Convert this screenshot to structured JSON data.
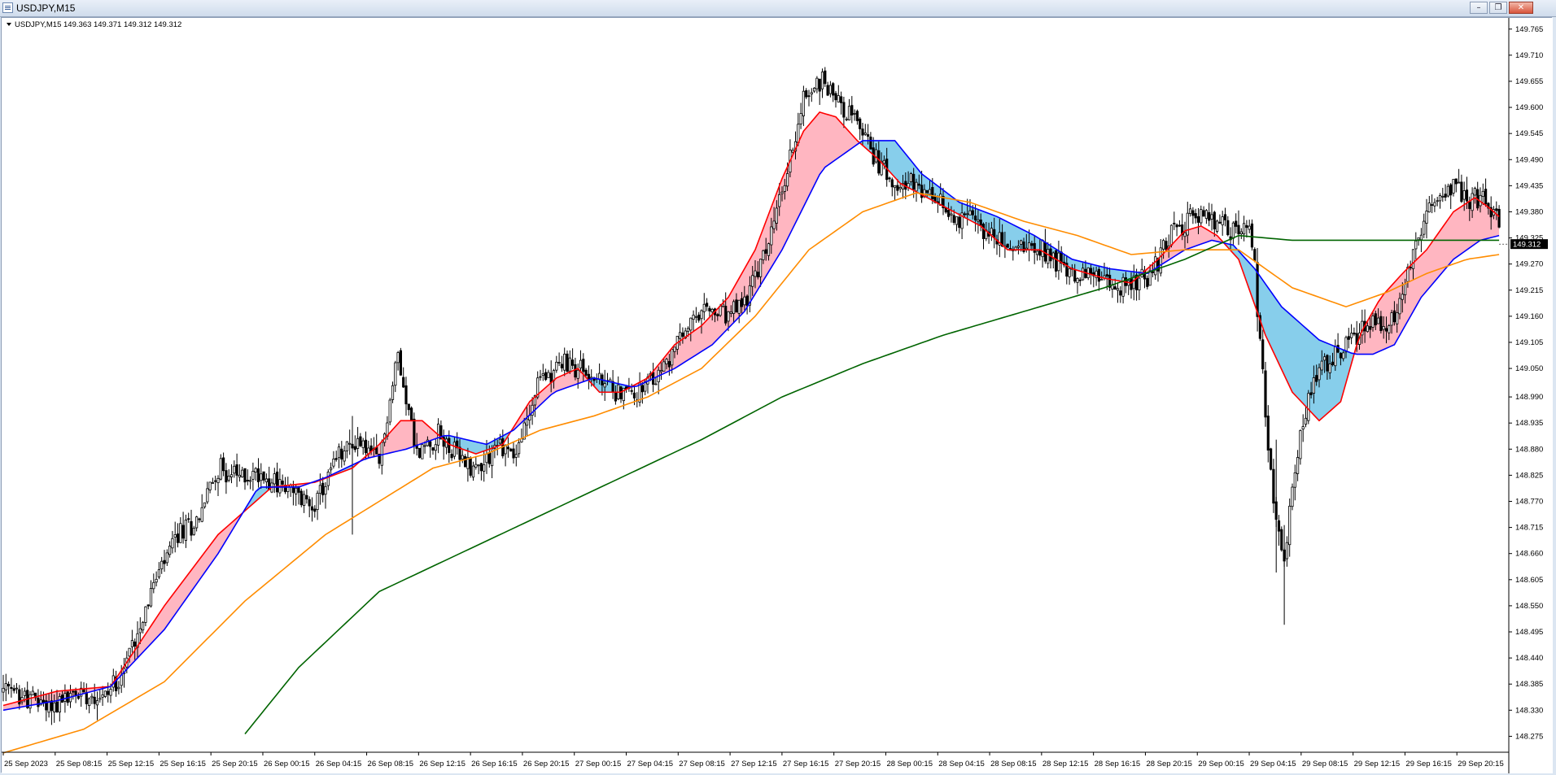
{
  "window": {
    "title": "USDJPY,M15",
    "buttons": [
      "minimize",
      "restore",
      "close"
    ]
  },
  "chart_data": {
    "type": "candlestick",
    "symbol_header": "USDJPY,M15  149.363 149.371 149.312 149.312",
    "current_price_label": "149.312",
    "ylim": [
      148.25,
      149.78
    ],
    "y_ticks": [
      "149.765",
      "149.710",
      "149.655",
      "149.600",
      "149.545",
      "149.490",
      "149.435",
      "149.380",
      "149.325",
      "149.270",
      "149.215",
      "149.160",
      "149.105",
      "149.050",
      "148.990",
      "148.935",
      "148.880",
      "148.825",
      "148.770",
      "148.715",
      "148.660",
      "148.605",
      "148.550",
      "148.495",
      "148.440",
      "148.385",
      "148.330",
      "148.275"
    ],
    "x_ticks": [
      "25 Sep 2023",
      "25 Sep 08:15",
      "25 Sep 12:15",
      "25 Sep 16:15",
      "25 Sep 20:15",
      "26 Sep 00:15",
      "26 Sep 04:15",
      "26 Sep 08:15",
      "26 Sep 12:15",
      "26 Sep 16:15",
      "26 Sep 20:15",
      "27 Sep 00:15",
      "27 Sep 04:15",
      "27 Sep 08:15",
      "27 Sep 12:15",
      "27 Sep 16:15",
      "27 Sep 20:15",
      "28 Sep 00:15",
      "28 Sep 04:15",
      "28 Sep 08:15",
      "28 Sep 12:15",
      "28 Sep 16:15",
      "28 Sep 20:15",
      "29 Sep 00:15",
      "29 Sep 04:15",
      "29 Sep 08:15",
      "29 Sep 12:15",
      "29 Sep 16:15",
      "29 Sep 20:15"
    ],
    "close_path": [
      [
        0,
        148.37
      ],
      [
        18,
        148.34
      ],
      [
        30,
        148.37
      ],
      [
        38,
        148.36
      ],
      [
        45,
        148.42
      ],
      [
        55,
        148.58
      ],
      [
        65,
        148.7
      ],
      [
        72,
        148.73
      ],
      [
        80,
        148.84
      ],
      [
        88,
        148.82
      ],
      [
        96,
        148.83
      ],
      [
        104,
        148.8
      ],
      [
        112,
        148.77
      ],
      [
        117,
        148.77
      ],
      [
        124,
        148.86
      ],
      [
        132,
        148.9
      ],
      [
        140,
        148.85
      ],
      [
        147,
        149.08
      ],
      [
        154,
        148.87
      ],
      [
        162,
        148.91
      ],
      [
        170,
        148.86
      ],
      [
        176,
        148.84
      ],
      [
        184,
        148.89
      ],
      [
        191,
        148.87
      ],
      [
        200,
        149.03
      ],
      [
        208,
        149.06
      ],
      [
        215,
        149.05
      ],
      [
        222,
        149.02
      ],
      [
        230,
        149.0
      ],
      [
        238,
        149.0
      ],
      [
        246,
        149.05
      ],
      [
        254,
        149.13
      ],
      [
        262,
        149.17
      ],
      [
        270,
        149.16
      ],
      [
        276,
        149.19
      ],
      [
        283,
        149.28
      ],
      [
        290,
        149.42
      ],
      [
        298,
        149.62
      ],
      [
        305,
        149.66
      ],
      [
        313,
        149.6
      ],
      [
        320,
        149.55
      ],
      [
        326,
        149.48
      ],
      [
        333,
        149.45
      ],
      [
        340,
        149.43
      ],
      [
        347,
        149.4
      ],
      [
        355,
        149.37
      ],
      [
        362,
        149.36
      ],
      [
        368,
        149.33
      ],
      [
        375,
        149.3
      ],
      [
        383,
        149.32
      ],
      [
        390,
        149.29
      ],
      [
        398,
        149.25
      ],
      [
        405,
        149.25
      ],
      [
        413,
        149.22
      ],
      [
        420,
        149.23
      ],
      [
        427,
        149.24
      ],
      [
        433,
        149.32
      ],
      [
        440,
        149.36
      ],
      [
        447,
        149.37
      ],
      [
        453,
        149.35
      ],
      [
        460,
        149.34
      ],
      [
        465,
        149.33
      ],
      [
        470,
        148.95
      ],
      [
        474,
        148.72
      ],
      [
        477,
        148.65
      ],
      [
        481,
        148.85
      ],
      [
        486,
        148.98
      ],
      [
        491,
        149.05
      ],
      [
        497,
        149.08
      ],
      [
        503,
        149.12
      ],
      [
        509,
        149.15
      ],
      [
        515,
        149.12
      ],
      [
        520,
        149.2
      ],
      [
        526,
        149.3
      ],
      [
        532,
        149.4
      ],
      [
        538,
        149.43
      ],
      [
        545,
        149.41
      ],
      [
        551,
        149.4
      ],
      [
        557,
        149.36
      ],
      [
        560,
        149.31
      ]
    ],
    "indicators": [
      {
        "name": "EMA fast",
        "color": "#ff0000",
        "points": [
          [
            0,
            148.34
          ],
          [
            20,
            148.37
          ],
          [
            40,
            148.38
          ],
          [
            60,
            148.55
          ],
          [
            80,
            148.7
          ],
          [
            100,
            148.8
          ],
          [
            116,
            148.81
          ],
          [
            130,
            148.84
          ],
          [
            140,
            148.89
          ],
          [
            148,
            148.94
          ],
          [
            156,
            148.94
          ],
          [
            166,
            148.89
          ],
          [
            176,
            148.87
          ],
          [
            186,
            148.89
          ],
          [
            196,
            148.98
          ],
          [
            206,
            149.03
          ],
          [
            214,
            149.05
          ],
          [
            222,
            149.0
          ],
          [
            230,
            149.0
          ],
          [
            240,
            149.03
          ],
          [
            250,
            149.1
          ],
          [
            260,
            149.14
          ],
          [
            270,
            149.2
          ],
          [
            280,
            149.3
          ],
          [
            290,
            149.45
          ],
          [
            298,
            149.55
          ],
          [
            304,
            149.59
          ],
          [
            310,
            149.58
          ],
          [
            318,
            149.53
          ],
          [
            326,
            149.49
          ],
          [
            334,
            149.44
          ],
          [
            344,
            149.41
          ],
          [
            354,
            149.38
          ],
          [
            364,
            149.35
          ],
          [
            374,
            149.3
          ],
          [
            386,
            149.3
          ],
          [
            398,
            149.26
          ],
          [
            410,
            149.24
          ],
          [
            420,
            149.23
          ],
          [
            430,
            149.28
          ],
          [
            440,
            149.34
          ],
          [
            446,
            149.35
          ],
          [
            452,
            149.33
          ],
          [
            460,
            149.28
          ],
          [
            470,
            149.12
          ],
          [
            480,
            149.0
          ],
          [
            490,
            148.94
          ],
          [
            498,
            148.98
          ],
          [
            505,
            149.12
          ],
          [
            513,
            149.2
          ],
          [
            521,
            149.25
          ],
          [
            530,
            149.3
          ],
          [
            540,
            149.38
          ],
          [
            548,
            149.41
          ],
          [
            553,
            149.39
          ],
          [
            557,
            149.37
          ]
        ]
      },
      {
        "name": "EMA medium",
        "color": "#0000ff",
        "points": [
          [
            0,
            148.33
          ],
          [
            20,
            148.35
          ],
          [
            40,
            148.38
          ],
          [
            60,
            148.5
          ],
          [
            80,
            148.66
          ],
          [
            95,
            148.8
          ],
          [
            110,
            148.8
          ],
          [
            120,
            148.82
          ],
          [
            135,
            148.86
          ],
          [
            150,
            148.88
          ],
          [
            165,
            148.91
          ],
          [
            180,
            148.89
          ],
          [
            190,
            148.92
          ],
          [
            205,
            149.0
          ],
          [
            220,
            149.03
          ],
          [
            235,
            149.01
          ],
          [
            250,
            149.05
          ],
          [
            264,
            149.1
          ],
          [
            276,
            149.17
          ],
          [
            290,
            149.3
          ],
          [
            305,
            149.47
          ],
          [
            320,
            149.53
          ],
          [
            332,
            149.53
          ],
          [
            342,
            149.46
          ],
          [
            356,
            149.4
          ],
          [
            370,
            149.37
          ],
          [
            384,
            149.33
          ],
          [
            398,
            149.28
          ],
          [
            412,
            149.26
          ],
          [
            426,
            149.25
          ],
          [
            440,
            149.3
          ],
          [
            450,
            149.32
          ],
          [
            458,
            149.31
          ],
          [
            466,
            149.26
          ],
          [
            476,
            149.18
          ],
          [
            490,
            149.11
          ],
          [
            503,
            149.08
          ],
          [
            510,
            149.08
          ],
          [
            518,
            149.1
          ],
          [
            528,
            149.2
          ],
          [
            540,
            149.28
          ],
          [
            550,
            149.32
          ],
          [
            557,
            149.33
          ]
        ]
      },
      {
        "name": "EMA slow",
        "color": "#ff8c00",
        "points": [
          [
            0,
            148.24
          ],
          [
            30,
            148.29
          ],
          [
            60,
            148.39
          ],
          [
            90,
            148.56
          ],
          [
            120,
            148.7
          ],
          [
            140,
            148.77
          ],
          [
            160,
            148.84
          ],
          [
            180,
            148.87
          ],
          [
            200,
            148.92
          ],
          [
            220,
            148.95
          ],
          [
            240,
            148.99
          ],
          [
            260,
            149.05
          ],
          [
            280,
            149.16
          ],
          [
            300,
            149.3
          ],
          [
            320,
            149.38
          ],
          [
            340,
            149.42
          ],
          [
            360,
            149.4
          ],
          [
            380,
            149.36
          ],
          [
            400,
            149.33
          ],
          [
            420,
            149.29
          ],
          [
            440,
            149.3
          ],
          [
            460,
            149.3
          ],
          [
            480,
            149.22
          ],
          [
            500,
            149.18
          ],
          [
            515,
            149.21
          ],
          [
            530,
            149.25
          ],
          [
            545,
            149.28
          ],
          [
            557,
            149.29
          ]
        ]
      },
      {
        "name": "SMA long",
        "color": "#006400",
        "points": [
          [
            90,
            148.28
          ],
          [
            110,
            148.42
          ],
          [
            140,
            148.58
          ],
          [
            170,
            148.66
          ],
          [
            200,
            148.74
          ],
          [
            230,
            148.82
          ],
          [
            260,
            148.9
          ],
          [
            290,
            148.99
          ],
          [
            320,
            149.06
          ],
          [
            350,
            149.12
          ],
          [
            380,
            149.17
          ],
          [
            410,
            149.22
          ],
          [
            440,
            149.28
          ],
          [
            460,
            149.33
          ],
          [
            480,
            149.32
          ],
          [
            500,
            149.32
          ],
          [
            520,
            149.32
          ],
          [
            540,
            149.32
          ],
          [
            557,
            149.32
          ]
        ]
      }
    ],
    "fill_bands": [
      {
        "between": [
          "EMA fast",
          "EMA medium"
        ],
        "colors": {
          "fast_above": "#ffb6c1",
          "medium_above": "#87ceeb"
        }
      }
    ]
  }
}
